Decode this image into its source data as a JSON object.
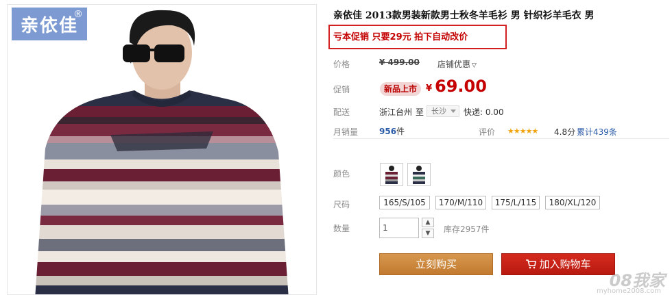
{
  "brand": {
    "logo_text": "亲依佳",
    "registered": "®"
  },
  "product": {
    "title": "亲依佳 2013款男装新款男士秋冬羊毛衫 男 针织衫羊毛衣 男",
    "promo": "亏本促销 只要29元 拍下自动改价",
    "price_label": "价格",
    "original_price": "¥ 499.00",
    "shop_discount": "店铺优惠",
    "promo_label": "促销",
    "new_badge": "新品上市",
    "currency": "¥",
    "sale_price": "69.00",
    "shipping_label": "配送",
    "ship_from": "浙江台州",
    "ship_to_word": "至",
    "ship_to_city": "长沙",
    "express": "快递: 0.00",
    "monthly_sales_label": "月销量",
    "monthly_sales_value": "956",
    "monthly_sales_unit": "件",
    "rating_label": "评价",
    "rating_stars": "★★★★★",
    "rating_score": "4.8分",
    "rating_total": "累计439条",
    "color_label": "颜色",
    "size_label": "尺码",
    "sizes": [
      "165/S/105",
      "170/M/110",
      "175/L/115",
      "180/XL/120"
    ],
    "qty_label": "数量",
    "qty_value": "1",
    "stock": "库存2957件",
    "buy_now": "立刻购买",
    "add_to_cart": "加入购物车"
  },
  "watermark": {
    "main": "08我家",
    "sub": "myhome2008.com"
  },
  "colors": {
    "accent_red": "#c40000",
    "buy_orange": "#c9843a",
    "cart_red": "#c8221a"
  }
}
